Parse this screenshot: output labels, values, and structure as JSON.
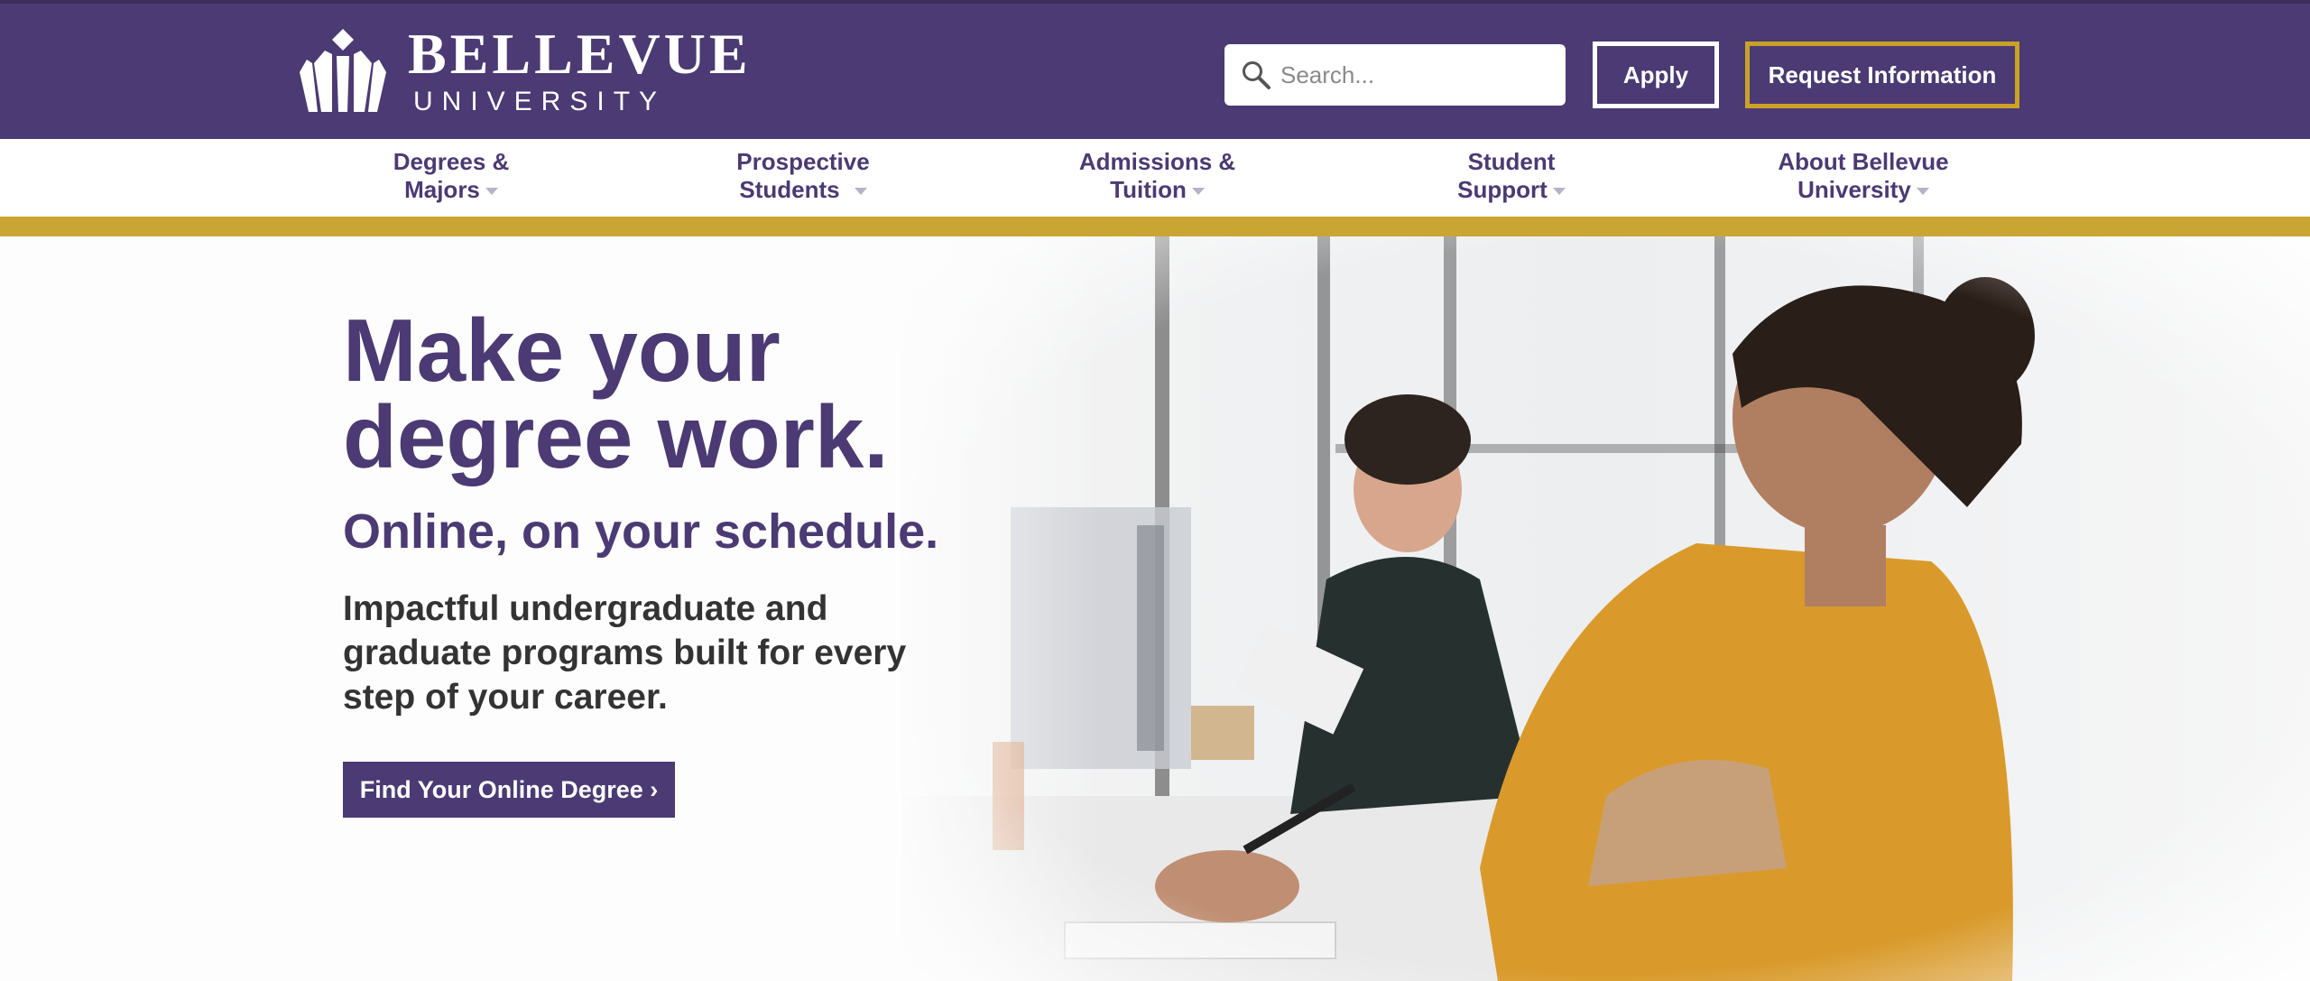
{
  "brand": {
    "name": "BELLEVUE",
    "subtitle": "UNIVERSITY",
    "colors": {
      "purple": "#4b3a73",
      "gold": "#c9a633",
      "white": "#ffffff"
    }
  },
  "header": {
    "search": {
      "placeholder": "Search...",
      "icon": "search-icon"
    },
    "apply_label": "Apply",
    "request_label": "Request Information"
  },
  "nav": {
    "items": [
      {
        "line1": "Degrees &",
        "line2": "Majors"
      },
      {
        "line1": "Prospective",
        "line2": "Students"
      },
      {
        "line1": "Admissions &",
        "line2": "Tuition"
      },
      {
        "line1": "Student",
        "line2": "Support"
      },
      {
        "line1": "About Bellevue",
        "line2": "University"
      }
    ]
  },
  "hero": {
    "headline_line1": "Make your",
    "headline_line2": "degree work.",
    "subheadline": "Online, on your schedule.",
    "body": "Impactful undergraduate and graduate programs built for every step of your career.",
    "cta_label": "Find Your Online Degree ›"
  }
}
